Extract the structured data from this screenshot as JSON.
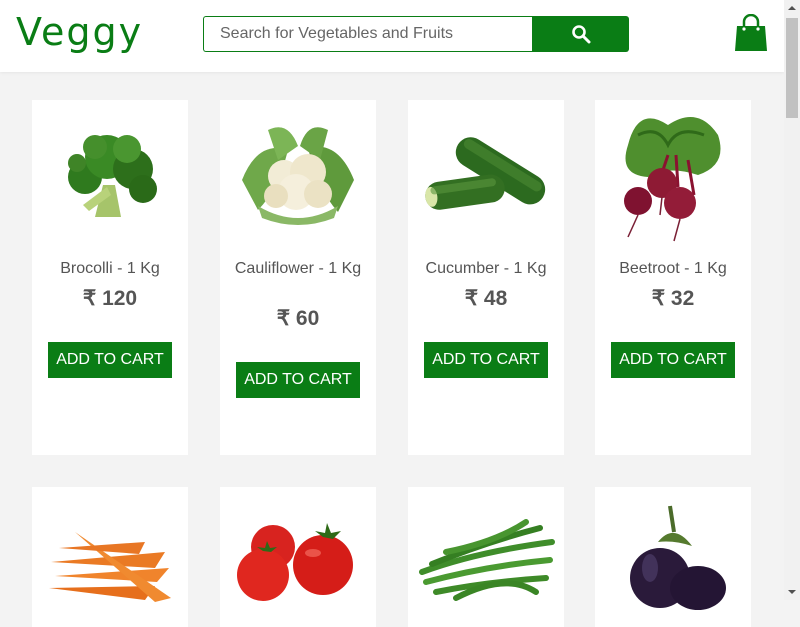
{
  "header": {
    "logo": "Veggy",
    "search": {
      "placeholder": "Search for Vegetables and Fruits",
      "value": ""
    },
    "search_button_icon": "search-icon",
    "cart_icon": "shopping-bag-icon"
  },
  "products": [
    {
      "name": "Brocolli - 1 Kg",
      "price": "₹ 120",
      "button": "ADD TO CART",
      "image": "broccoli"
    },
    {
      "name": "Cauliflower - 1 Kg",
      "price": "₹ 60",
      "button": "ADD TO CART",
      "image": "cauliflower"
    },
    {
      "name": "Cucumber - 1 Kg",
      "price": "₹ 48",
      "button": "ADD TO CART",
      "image": "cucumber"
    },
    {
      "name": "Beetroot - 1 Kg",
      "price": "₹ 32",
      "button": "ADD TO CART",
      "image": "beetroot"
    },
    {
      "image": "carrot"
    },
    {
      "image": "tomato"
    },
    {
      "image": "beans"
    },
    {
      "image": "brinjal"
    }
  ],
  "colors": {
    "brand_green": "#0a7d15",
    "page_bg": "#f3f3f3",
    "card_bg": "#ffffff",
    "text": "#555555"
  }
}
